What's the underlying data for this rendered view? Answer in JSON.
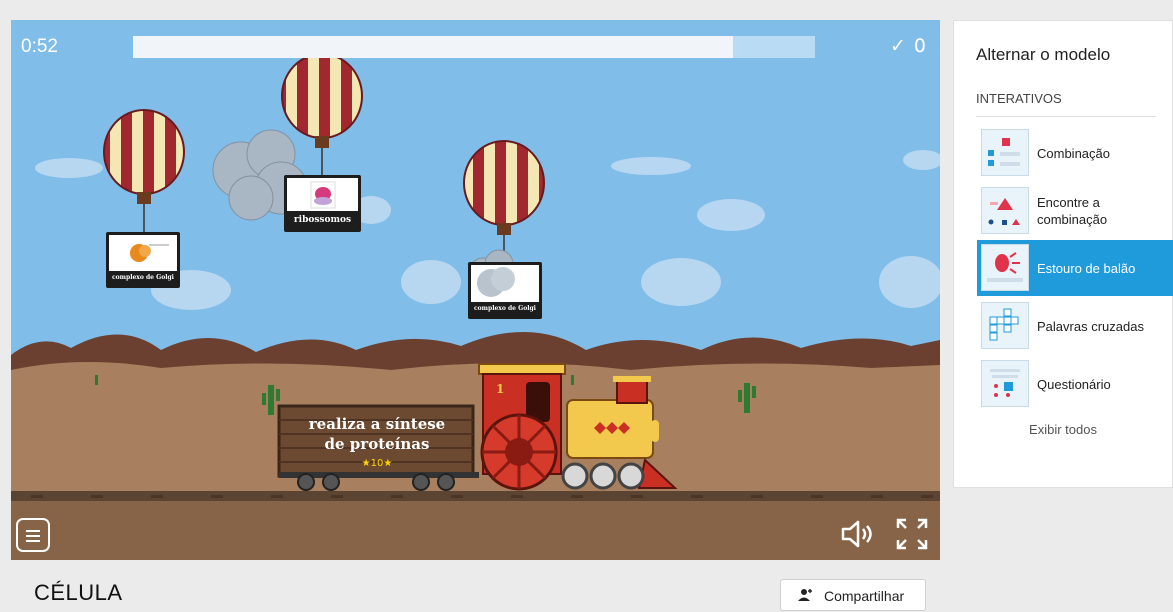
{
  "game": {
    "timer": "0:52",
    "progress_fraction": 0.88,
    "score": "0",
    "score_check": "✓",
    "balloons": [
      {
        "label": "complexo de Golgi",
        "image_caption": "COMPLEXO..."
      },
      {
        "label": "ribossomos",
        "image_caption": ""
      },
      {
        "label": "complexo de Golgi",
        "image_caption": ""
      }
    ],
    "wagon": {
      "line1": "realiza a síntese",
      "line2": "de proteínas",
      "stars": "★10★"
    },
    "locomotive_number": "1"
  },
  "icons": {
    "menu": "menu-icon",
    "sound": "speaker-icon",
    "fullscreen": "fullscreen-icon",
    "share": "user-share-icon"
  },
  "sidebar": {
    "title": "Alternar o modelo",
    "section": "INTERATIVOS",
    "items": [
      {
        "label": "Combinação"
      },
      {
        "label": "Encontre a combinação"
      },
      {
        "label": "Estouro de balão"
      },
      {
        "label": "Palavras cruzadas"
      },
      {
        "label": "Questionário"
      }
    ],
    "show_all": "Exibir todos"
  },
  "page": {
    "title": "CÉLULA",
    "share_label": "Compartilhar"
  },
  "colors": {
    "sky": "#80bde9",
    "accent": "#1f9bdc",
    "desert": "#a9805f"
  }
}
